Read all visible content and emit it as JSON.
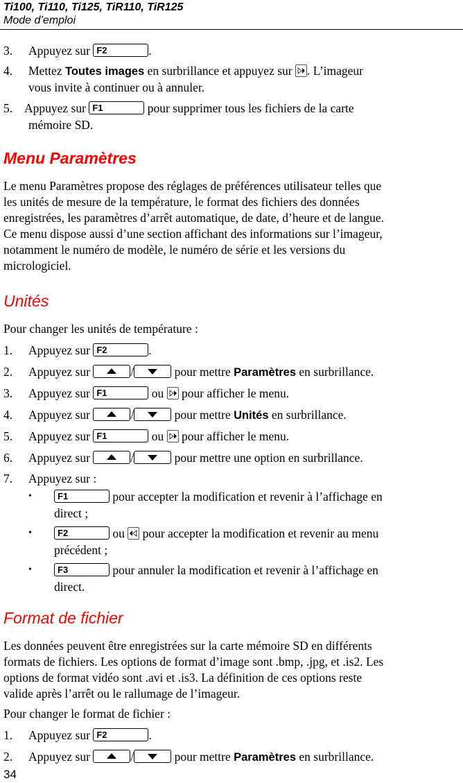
{
  "header": {
    "title": "Ti100, Ti110, Ti125, TiR110, TiR125",
    "subtitle": "Mode d’emploi"
  },
  "keys": {
    "f1": "F1",
    "f2": "F2",
    "f3": "F3",
    "up_arrow_icon": "up-triangle",
    "down_arrow_icon": "down-triangle",
    "right_nav_icon": "right-arrow-key",
    "left_nav_icon": "left-arrow-key"
  },
  "intro_steps": [
    {
      "num": "3.",
      "pre": "Appuyez sur",
      "post": "."
    },
    {
      "num": "4.",
      "pre": "Mettez",
      "bold": "Toutes images",
      "mid": "en surbrillance et appuyez sur",
      "post": ". L’imageur",
      "cont": "vous invite à continuer ou à annuler."
    },
    {
      "num": "5.",
      "pre": "Appuyez sur",
      "post": "pour supprimer tous les fichiers de la carte",
      "cont": "mémoire SD."
    }
  ],
  "menu_section": {
    "title": "Menu Paramètres",
    "paragraph_lines": [
      "Le menu Paramètres propose des réglages de préférences utilisateur telles que",
      "les unités de mesure de la température, le format des fichiers des données",
      "enregistrées, les paramètres d’arrêt automatique, de date, d’heure et de langue.",
      "Ce menu dispose aussi d’une section affichant des informations sur l’imageur,",
      "notamment le numéro de modèle, le numéro de série et les versions du",
      "micrologiciel."
    ]
  },
  "units_section": {
    "title": "Unités",
    "intro": "Pour changer les unités de température :",
    "steps": [
      {
        "num": "1.",
        "pre": "Appuyez sur",
        "post": "."
      },
      {
        "num": "2.",
        "pre": "Appuyez sur",
        "mid": "pour mettre",
        "bold": "Paramètres",
        "post": "en surbrillance."
      },
      {
        "num": "3.",
        "pre": "Appuyez sur",
        "mid": "ou",
        "post": "pour afficher le menu."
      },
      {
        "num": "4.",
        "pre": "Appuyez sur",
        "mid": "pour mettre",
        "bold": "Unités",
        "post": "en surbrillance."
      },
      {
        "num": "5.",
        "pre": "Appuyez sur",
        "mid": "ou",
        "post": "pour afficher le menu."
      },
      {
        "num": "6.",
        "pre": "Appuyez sur",
        "post": "pour mettre une option en surbrillance."
      },
      {
        "num": "7.",
        "pre": "Appuyez sur :"
      }
    ],
    "bullets": [
      {
        "text": "pour accepter la modification et revenir à l’affichage en",
        "cont": "direct ;"
      },
      {
        "mid": "ou",
        "text": "pour accepter la modification et revenir au menu",
        "cont": "précédent ;"
      },
      {
        "text": "pour annuler la modification et revenir à l’affichage en",
        "cont": "direct."
      }
    ],
    "bullet_char": "•"
  },
  "format_section": {
    "title": "Format de fichier",
    "paragraph_lines": [
      "Les données peuvent être enregistrées sur la carte mémoire SD en différents",
      "formats de fichiers. Les options de format d’image sont .bmp, .jpg, et .is2. Les",
      "options de format vidéo sont .avi et .is3. La définition de ces options reste",
      "valide après l’arrêt ou le rallumage de l’imageur."
    ],
    "intro": "Pour changer le format de fichier :",
    "steps": [
      {
        "num": "1.",
        "pre": "Appuyez sur",
        "post": "."
      },
      {
        "num": "2.",
        "pre": "Appuyez sur",
        "mid": "pour mettre",
        "bold": "Paramètres",
        "post": "en surbrillance."
      }
    ]
  },
  "footer": {
    "page_number": "34"
  },
  "colors": {
    "heading": "#ff0000",
    "text": "#000000"
  }
}
